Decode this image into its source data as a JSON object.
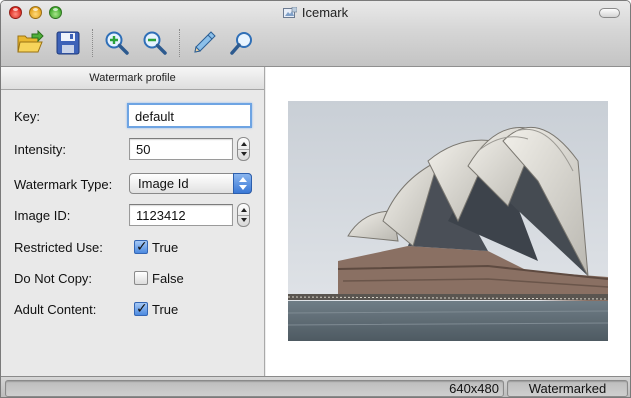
{
  "window": {
    "title": "Icemark"
  },
  "toolbar": {
    "buttons": [
      {
        "name": "open",
        "icon": "open-folder-icon"
      },
      {
        "name": "save",
        "icon": "floppy-disk-icon"
      },
      {
        "name": "zoom-in",
        "icon": "zoom-in-icon"
      },
      {
        "name": "zoom-out",
        "icon": "zoom-out-icon"
      },
      {
        "name": "pencil",
        "icon": "pencil-icon"
      },
      {
        "name": "inspect",
        "icon": "magnifier-icon"
      }
    ]
  },
  "profile": {
    "header": "Watermark profile",
    "key": {
      "label": "Key:",
      "value": "default"
    },
    "intensity": {
      "label": "Intensity:",
      "value": "50"
    },
    "watermark_type": {
      "label": "Watermark Type:",
      "value": "Image Id"
    },
    "image_id": {
      "label": "Image ID:",
      "value": "1123412"
    },
    "restricted_use": {
      "label": "Restricted Use:",
      "checked": true,
      "text": "True"
    },
    "do_not_copy": {
      "label": "Do Not Copy:",
      "checked": false,
      "text": "False"
    },
    "adult_content": {
      "label": "Adult Content:",
      "checked": true,
      "text": "True"
    }
  },
  "preview": {
    "image": "sydney-opera-house-photo"
  },
  "status": {
    "dimensions": "640x480",
    "state": "Watermarked"
  },
  "colors": {
    "accent": "#3a78d6",
    "focus_ring": "#6ea4e3"
  }
}
